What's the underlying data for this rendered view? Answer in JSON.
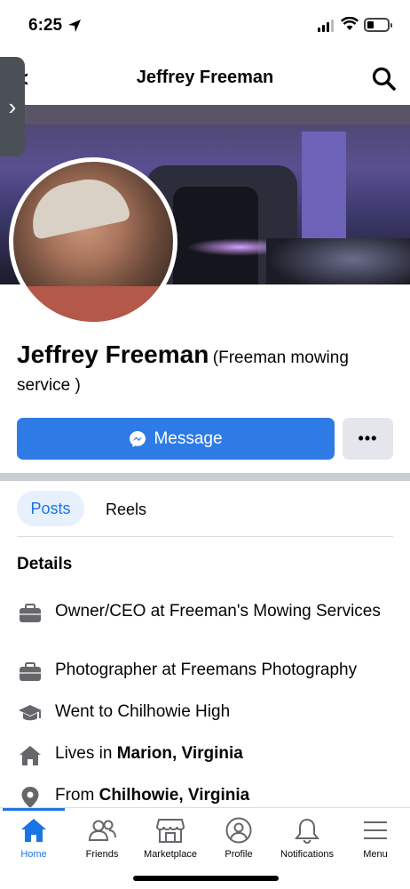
{
  "status_bar": {
    "time": "6:25"
  },
  "header": {
    "title": "Jeffrey Freeman"
  },
  "profile": {
    "name": "Jeffrey Freeman",
    "alt_name_line1": "(Freeman mowing",
    "alt_name_line2": "service )"
  },
  "actions": {
    "message_label": "Message",
    "more_label": "•••"
  },
  "tabs": [
    {
      "label": "Posts"
    },
    {
      "label": "Reels"
    }
  ],
  "details": {
    "title": "Details",
    "items": [
      {
        "icon": "briefcase-icon",
        "text": "Owner/CEO at Freeman's Mowing Services"
      },
      {
        "icon": "briefcase-icon",
        "text": "Photographer at Freemans Photography"
      },
      {
        "icon": "graduation-cap-icon",
        "text": "Went to Chilhowie High"
      },
      {
        "icon": "home-icon",
        "prefix": "Lives in ",
        "bold": "Marion, Virginia"
      },
      {
        "icon": "location-pin-icon",
        "prefix": "From ",
        "bold": "Chilhowie, Virginia"
      }
    ]
  },
  "bottom_nav": {
    "items": [
      {
        "label": "Home",
        "active": true
      },
      {
        "label": "Friends"
      },
      {
        "label": "Marketplace"
      },
      {
        "label": "Profile"
      },
      {
        "label": "Notifications"
      },
      {
        "label": "Menu"
      }
    ]
  },
  "colors": {
    "accent": "#1b74e4",
    "message_button": "#2f7be6"
  }
}
